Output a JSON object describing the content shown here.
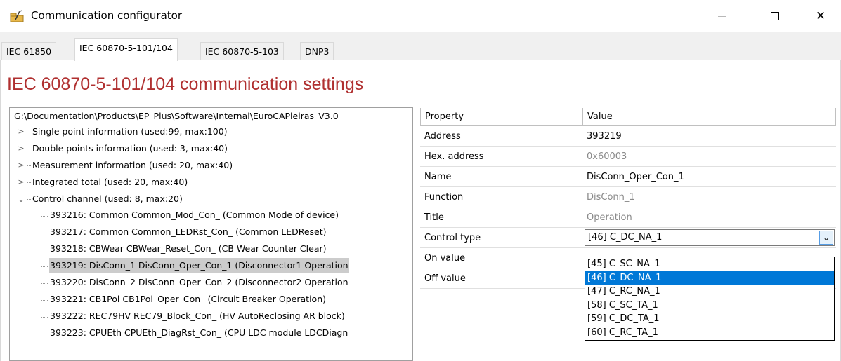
{
  "window": {
    "title": "Communication configurator",
    "close_glyph": "✕"
  },
  "tabs": [
    {
      "label": "IEC 61850",
      "active": false
    },
    {
      "label": "IEC 60870-5-101/104",
      "active": true
    },
    {
      "label": "IEC 60870-5-103",
      "active": false
    },
    {
      "label": "DNP3",
      "active": false
    }
  ],
  "main": {
    "heading": "IEC 60870-5-101/104 communication settings",
    "heading_color": "#b03030"
  },
  "tree": {
    "root_path": "G:\\Documentation\\Products\\EP_Plus\\Software\\Internal\\EuroCAPleiras_V3.0_",
    "groups": [
      {
        "label": "Single point information (used:99, max:100)",
        "expanded": false
      },
      {
        "label": "Double points information (used: 3, max:40)",
        "expanded": false
      },
      {
        "label": "Measurement information (used: 20, max:40)",
        "expanded": false
      },
      {
        "label": "Integrated total (used: 20, max:40)",
        "expanded": false
      },
      {
        "label": "Control channel (used: 8, max:20)",
        "expanded": true
      }
    ],
    "control_items": [
      "393216: Common Common_Mod_Con_ (Common Mode of device)",
      "393217: Common Common_LEDRst_Con_ (Common LEDReset)",
      "393218: CBWear CBWear_Reset_Con_ (CB Wear Counter Clear)",
      "393219: DisConn_1 DisConn_Oper_Con_1 (Disconnector1 Operation",
      "393220: DisConn_2 DisConn_Oper_Con_2 (Disconnector2 Operation",
      "393221: CB1Pol CB1Pol_Oper_Con_ (Circuit Breaker Operation)",
      "393222: REC79HV REC79_Block_Con_ (HV AutoReclosing AR block)",
      "393223: CPUEth CPUEth_DiagRst_Con_ (CPU LDC module LDCDiagn"
    ],
    "selected_index": 3
  },
  "grid": {
    "header_property": "Property",
    "header_value": "Value",
    "rows": [
      {
        "property": "Address",
        "value": "393219",
        "dim": false
      },
      {
        "property": "Hex. address",
        "value": "0x60003",
        "dim": true
      },
      {
        "property": "Name",
        "value": "DisConn_Oper_Con_1",
        "dim": false
      },
      {
        "property": "Function",
        "value": "DisConn_1",
        "dim": true
      },
      {
        "property": "Title",
        "value": "Operation",
        "dim": true
      },
      {
        "property": "Control type",
        "value": "[46] C_DC_NA_1",
        "dim": false
      },
      {
        "property": "On value",
        "value": "",
        "dim": false
      },
      {
        "property": "Off value",
        "value": "",
        "dim": false
      }
    ]
  },
  "dropdown": {
    "options": [
      "[45] C_SC_NA_1",
      "[46] C_DC_NA_1",
      "[47] C_RC_NA_1",
      "[58] C_SC_TA_1",
      "[59] C_DC_TA_1",
      "[60] C_RC_TA_1"
    ],
    "selected_index": 1,
    "highlight_color": "#0078d7"
  }
}
